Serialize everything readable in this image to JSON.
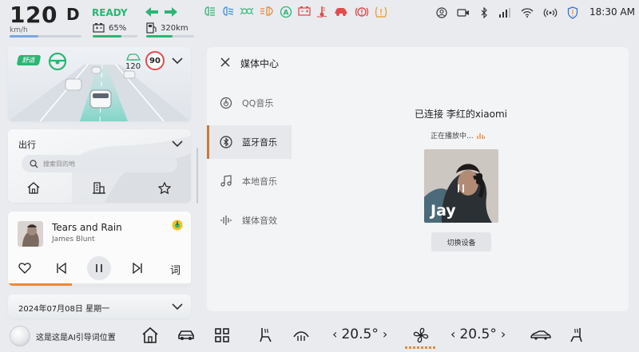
{
  "status": {
    "speed": "120",
    "speed_unit": "km/h",
    "speed_fraction": 0.4,
    "gear": "D",
    "ready": "READY",
    "battery_percent": "65%",
    "battery_fraction": 0.65,
    "range": "320km",
    "range_fraction": 0.55,
    "clock": "18:30 AM",
    "telltales": [
      "high-beam-icon",
      "low-beam-icon",
      "sidelight-icon",
      "fog-light-icon",
      "auto-hold-icon",
      "battery-warning-icon",
      "coolant-temp-icon",
      "door-open-icon",
      "brake-warning-icon",
      "tire-pressure-icon"
    ],
    "system_icons": [
      "user-icon",
      "camera-icon",
      "bluetooth-icon",
      "signal-icon",
      "wifi-icon",
      "hotspot-icon",
      "shield-icon"
    ],
    "accent_green": "#2bb673"
  },
  "adas": {
    "mode_badge": "舒适",
    "set_speed": "120",
    "speed_limit": "90"
  },
  "trip": {
    "title": "出行",
    "search_placeholder": "搜索目的地",
    "shortcuts": [
      "home-icon",
      "company-icon",
      "favorite-icon"
    ]
  },
  "music_card": {
    "song": "Tears and Rain",
    "artist": "James Blunt",
    "lyrics_label": "词",
    "progress": 0.35
  },
  "date": {
    "text": "2024年07月08日 星期一"
  },
  "media": {
    "title": "媒体中心",
    "sources": [
      {
        "label": "QQ音乐",
        "icon": "qq-music-icon"
      },
      {
        "label": "蓝牙音乐",
        "icon": "bluetooth-icon"
      },
      {
        "label": "本地音乐",
        "icon": "music-note-icon"
      },
      {
        "label": "媒体音效",
        "icon": "sound-wave-icon"
      }
    ],
    "active_source": "蓝牙音乐",
    "connected_text": "已连接 李红的xiaomi",
    "playing_text": "正在播放中...",
    "album_text": "Jay",
    "switch_device": "切换设备",
    "accent": "#c87a3b"
  },
  "dock": {
    "assistant_text": "这是这是AI引导词位置",
    "left_temp": "20.5°",
    "right_temp": "20.5°"
  }
}
